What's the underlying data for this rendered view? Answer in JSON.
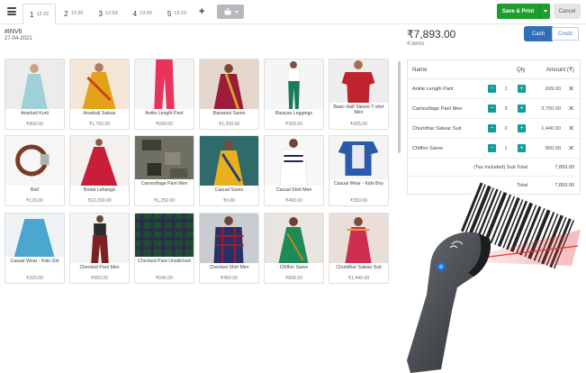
{
  "header": {
    "tabs": [
      {
        "num": "1",
        "time": "12:22",
        "active": true
      },
      {
        "num": "2",
        "time": "12:35",
        "active": false
      },
      {
        "num": "3",
        "time": "12:59",
        "active": false
      },
      {
        "num": "4",
        "time": "13:00",
        "active": false
      },
      {
        "num": "5",
        "time": "13:10",
        "active": false
      }
    ],
    "add_tab_label": "+",
    "save_print_label": "Save & Print",
    "cancel_label": "Cancel"
  },
  "invoice": {
    "number": "#INV6",
    "date": "27-04-2021"
  },
  "products": [
    {
      "name": "Anarkali Kurti",
      "price": "₹800.00"
    },
    {
      "name": "Anarkali Salwar",
      "price": "₹1,700.00"
    },
    {
      "name": "Ankle Length Pant",
      "price": "₹699.00"
    },
    {
      "name": "Banarasi Saree",
      "price": "₹1,200.00"
    },
    {
      "name": "Basiyan Leggings",
      "price": "₹300.00"
    },
    {
      "name": "Basic Half Sleeve T shirt Men",
      "price": "₹425.00"
    },
    {
      "name": "Belt",
      "price": "₹120.00"
    },
    {
      "name": "Bridal Lehanga",
      "price": "₹22,000.00"
    },
    {
      "name": "Camouflage Pant Men",
      "price": "₹1,250.00"
    },
    {
      "name": "Casual Saree",
      "price": "₹0.00"
    },
    {
      "name": "Casual Shirt Men",
      "price": "₹400.00"
    },
    {
      "name": "Casual Wear - Kids Boy",
      "price": "₹350.00"
    },
    {
      "name": "Casual Wear - Kids Girl",
      "price": "₹320.00"
    },
    {
      "name": "Checked Pant Men",
      "price": "₹950.00"
    },
    {
      "name": "Checked Pant Unstitched",
      "price": "₹645.00"
    },
    {
      "name": "Checked Shirt Men",
      "price": "₹450.00"
    },
    {
      "name": "Chiffon Saree",
      "price": "₹800.00"
    },
    {
      "name": "Churidhar Salwar Suit",
      "price": "₹1,440.00"
    }
  ],
  "summary": {
    "total": "₹7,893.00",
    "items_count": "4 items",
    "cash_label": "Cash",
    "credit_label": "Credit"
  },
  "cart": {
    "headers": {
      "name": "Name",
      "qty": "Qty",
      "amount": "Amount (₹)"
    },
    "rows": [
      {
        "name": "Ankle Length Pant",
        "qty": "1",
        "amount": "699.00"
      },
      {
        "name": "Camouflage Pant Men",
        "qty": "3",
        "amount": "3,750.00"
      },
      {
        "name": "Churidhar Salwar Suit",
        "qty": "2",
        "amount": "1,440.00"
      },
      {
        "name": "Chiffon Saree",
        "qty": "1",
        "amount": "800.00"
      }
    ],
    "subtotal_label": "(Tax Included) Sub Total",
    "subtotal_value": "7,893.00",
    "total_label": "Total",
    "total_value": "7,893.00"
  },
  "colors": {
    "accent_green": "#1e9e2f",
    "accent_blue": "#2f6fb8",
    "qty_button": "#179b97",
    "delete_icon": "#2d5fa0"
  }
}
